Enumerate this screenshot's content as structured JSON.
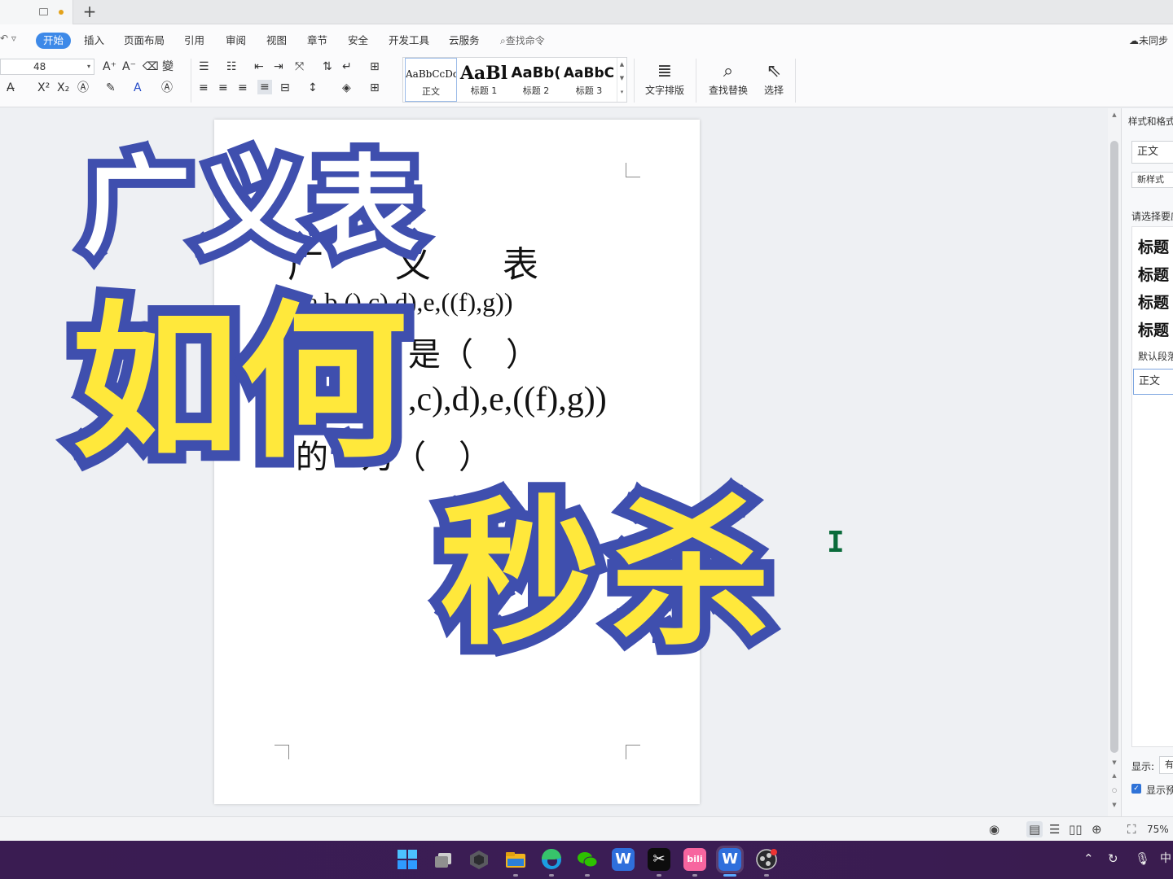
{
  "window": {
    "new_tab": "+"
  },
  "menu": {
    "undo": "↶ ▿",
    "items": [
      "开始",
      "插入",
      "页面布局",
      "引用",
      "审阅",
      "视图",
      "章节",
      "安全",
      "开发工具",
      "云服务"
    ],
    "search": "查找命令",
    "sync": "未同步"
  },
  "ribbon": {
    "font_size": "48",
    "style_gallery": [
      {
        "sample": "AaBbCcDd",
        "name": "正文"
      },
      {
        "sample": "AaBl",
        "name": "标题 1"
      },
      {
        "sample": "AaBb(",
        "name": "标题 2"
      },
      {
        "sample": "AaBbC",
        "name": "标题 3"
      }
    ],
    "text_layout": "文字排版",
    "find_replace": "查找替换",
    "select": "选择"
  },
  "document": {
    "line1": "广　　义　　表",
    "line2": "((a,b,(),c),d),e,((f),g))",
    "line3": "是（　）",
    "line4": ",c),d),e,((f),g))",
    "line5": "的　为（　）"
  },
  "overlay": {
    "title_a": "广义表",
    "title_b": "如何",
    "title_c": "秒杀"
  },
  "panel": {
    "title": "样式和格式",
    "current_style": "正文",
    "new_style": "新样式",
    "choose_label": "请选择要应用的格式",
    "headings": [
      "标题",
      "标题",
      "标题",
      "标题"
    ],
    "default_font": "默认段落字体",
    "selected": "正文",
    "display_label": "显示:",
    "display_value": "有效样式",
    "show_preview": "显示预览"
  },
  "status": {
    "zoom": "75%"
  },
  "taskbar": {
    "tray_lang": "中"
  },
  "colors": {
    "accent": "#3d89e8",
    "caption_stroke": "#3f4fae",
    "caption_yellow": "#ffe83b",
    "taskbar": "#3b1d55"
  }
}
